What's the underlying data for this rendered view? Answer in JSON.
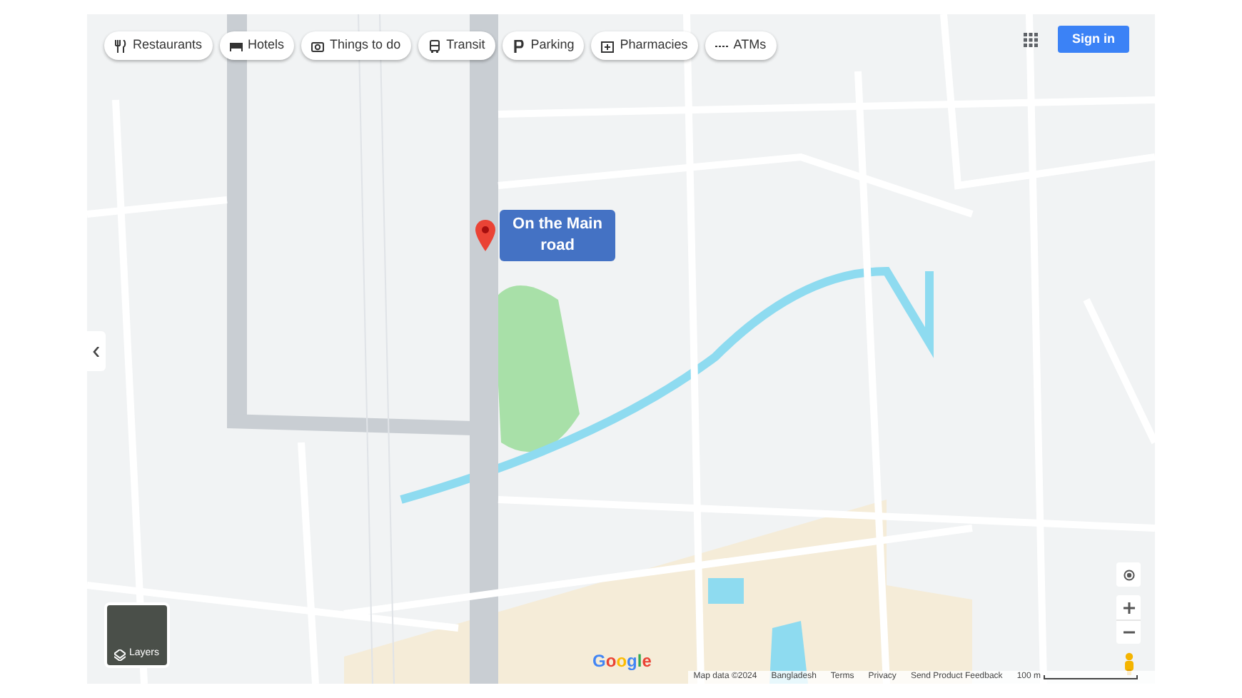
{
  "chips": [
    {
      "label": "Restaurants",
      "kind": "food"
    },
    {
      "label": "Hotels",
      "kind": "bed"
    },
    {
      "label": "Things to do",
      "kind": "camera"
    },
    {
      "label": "Transit",
      "kind": "bus"
    },
    {
      "label": "Parking",
      "kind": "parking"
    },
    {
      "label": "Pharmacies",
      "kind": "pharmacy"
    },
    {
      "label": "ATMs",
      "kind": "atm"
    }
  ],
  "sign_in": "Sign in",
  "marker": {
    "label": "On the Main road"
  },
  "layers": {
    "label": "Layers"
  },
  "logo": "Google",
  "footer": {
    "items": [
      "Map data ©2024",
      "Bangladesh",
      "Terms",
      "Privacy",
      "Send Product Feedback"
    ],
    "scale": "100 m"
  }
}
